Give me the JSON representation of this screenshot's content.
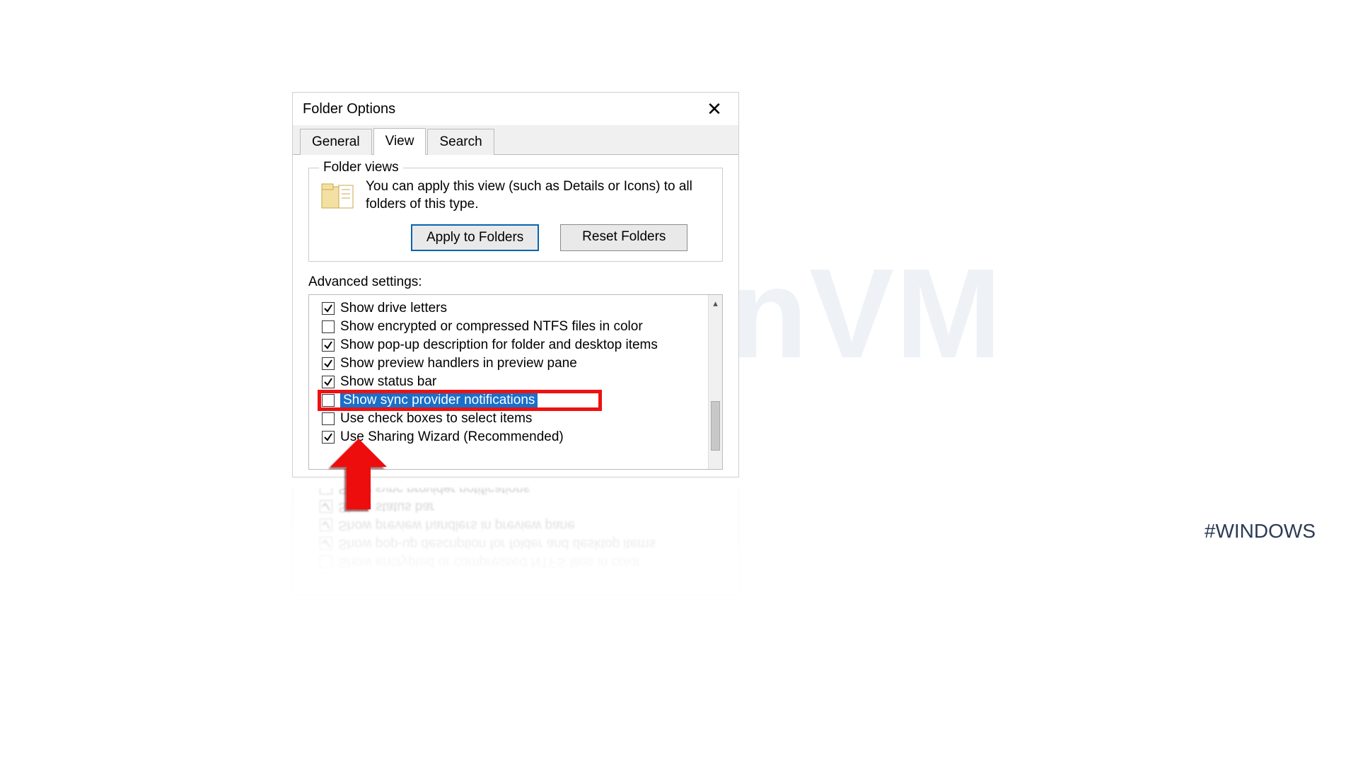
{
  "watermark": "NeuronVM",
  "hashtag": "#WINDOWS",
  "dialog": {
    "title": "Folder Options",
    "tabs": {
      "general": "General",
      "view": "View",
      "search": "Search"
    },
    "folderviews": {
      "group_label": "Folder views",
      "description": "You can apply this view (such as Details or Icons) to all folders of this type.",
      "apply_btn": "Apply to Folders",
      "reset_btn": "Reset Folders"
    },
    "advanced": {
      "label": "Advanced settings:",
      "items": [
        {
          "label": "Show drive letters",
          "checked": true
        },
        {
          "label": "Show encrypted or compressed NTFS files in color",
          "checked": false
        },
        {
          "label": "Show pop-up description for folder and desktop items",
          "checked": true
        },
        {
          "label": "Show preview handlers in preview pane",
          "checked": true
        },
        {
          "label": "Show status bar",
          "checked": true
        },
        {
          "label": "Show sync provider notifications",
          "checked": false,
          "highlighted": true
        },
        {
          "label": "Use check boxes to select items",
          "checked": false
        },
        {
          "label": "Use Sharing Wizard (Recommended)",
          "checked": true
        }
      ]
    }
  }
}
